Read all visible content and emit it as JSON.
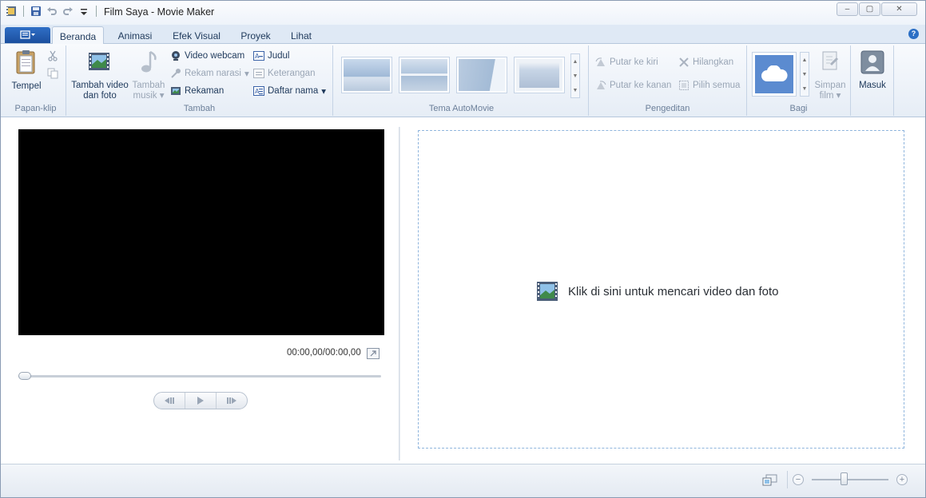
{
  "window": {
    "title": "Film Saya - Movie Maker",
    "buttons": {
      "minimize": "–",
      "maximize": "▢",
      "close": "✕"
    }
  },
  "tabs": [
    {
      "label": "Beranda",
      "active": true
    },
    {
      "label": "Animasi"
    },
    {
      "label": "Efek Visual"
    },
    {
      "label": "Proyek"
    },
    {
      "label": "Lihat"
    }
  ],
  "file_menu_icon": "file-menu-icon",
  "help_label": "?",
  "ribbon": {
    "clipboard": {
      "label": "Papan-klip",
      "paste": "Tempel"
    },
    "add": {
      "label": "Tambah",
      "add_video_photo_l1": "Tambah video",
      "add_video_photo_l2": "dan foto",
      "add_music_l1": "Tambah",
      "add_music_l2": "musik",
      "webcam_video": "Video webcam",
      "record_narration": "Rekam narasi",
      "snapshot": "Rekaman",
      "title": "Judul",
      "caption": "Keterangan",
      "credits": "Daftar nama"
    },
    "automovie": {
      "label": "Tema AutoMovie"
    },
    "editing": {
      "label": "Pengeditan",
      "rotate_left": "Putar ke kiri",
      "rotate_right": "Putar ke kanan",
      "remove": "Hilangkan",
      "select_all": "Pilih semua"
    },
    "share": {
      "label": "Bagi",
      "save_movie_l1": "Simpan",
      "save_movie_l2": "film"
    },
    "sign_in": "Masuk"
  },
  "preview": {
    "timecode": "00:00,00/00:00,00"
  },
  "storyboard": {
    "hint": "Klik di sini untuk mencari video dan foto"
  },
  "statusbar": {
    "zoom_minus": "−",
    "zoom_plus": "+"
  }
}
